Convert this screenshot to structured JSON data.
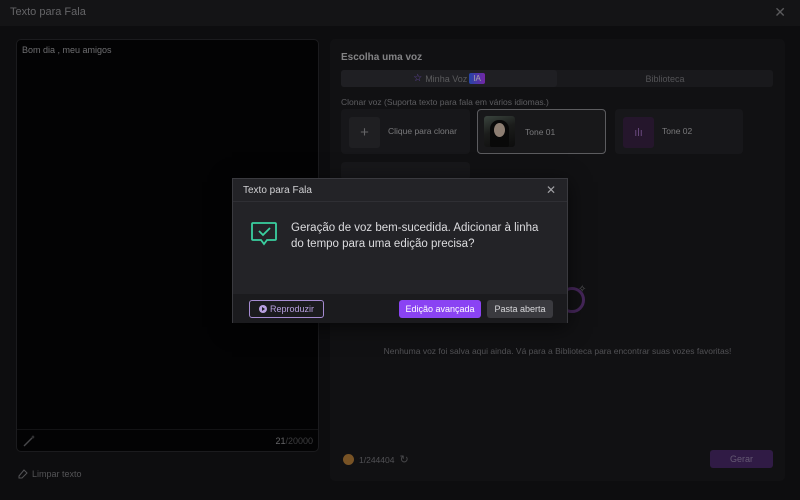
{
  "window": {
    "title": "Texto para Fala",
    "close_icon": "close-icon"
  },
  "editor": {
    "text": "Bom dia , meu amigos",
    "count_current": "21",
    "count_max": "/20000",
    "wand_icon": "magic-wand-icon"
  },
  "clear_label": "Limpar texto",
  "voice_panel": {
    "heading": "Escolha uma voz",
    "tabs": {
      "my_voice": "Minha Voz",
      "ia_badge": "IA",
      "library": "Biblioteca"
    },
    "clone_label": "Clonar voz (Suporta texto para fala em vários idiomas.)",
    "cards": {
      "clone": "Clique para clonar",
      "tone1": "Tone 01",
      "tone2": "Tone 02"
    },
    "empty_text": "Nenhuma voz foi salva aqui ainda. Vá para a Biblioteca para encontrar suas vozes favoritas!",
    "credits": "1/244404",
    "generate": "Gerar"
  },
  "dialog": {
    "title": "Texto para Fala",
    "message": "Geração de voz bem-sucedida. Adicionar à linha do tempo para uma edição precisa?",
    "play": "Reproduzir",
    "advanced": "Edição avançada",
    "open_folder": "Pasta aberta"
  },
  "colors": {
    "accent": "#8a43f3",
    "success": "#3ad0a0",
    "background": "#141417"
  }
}
